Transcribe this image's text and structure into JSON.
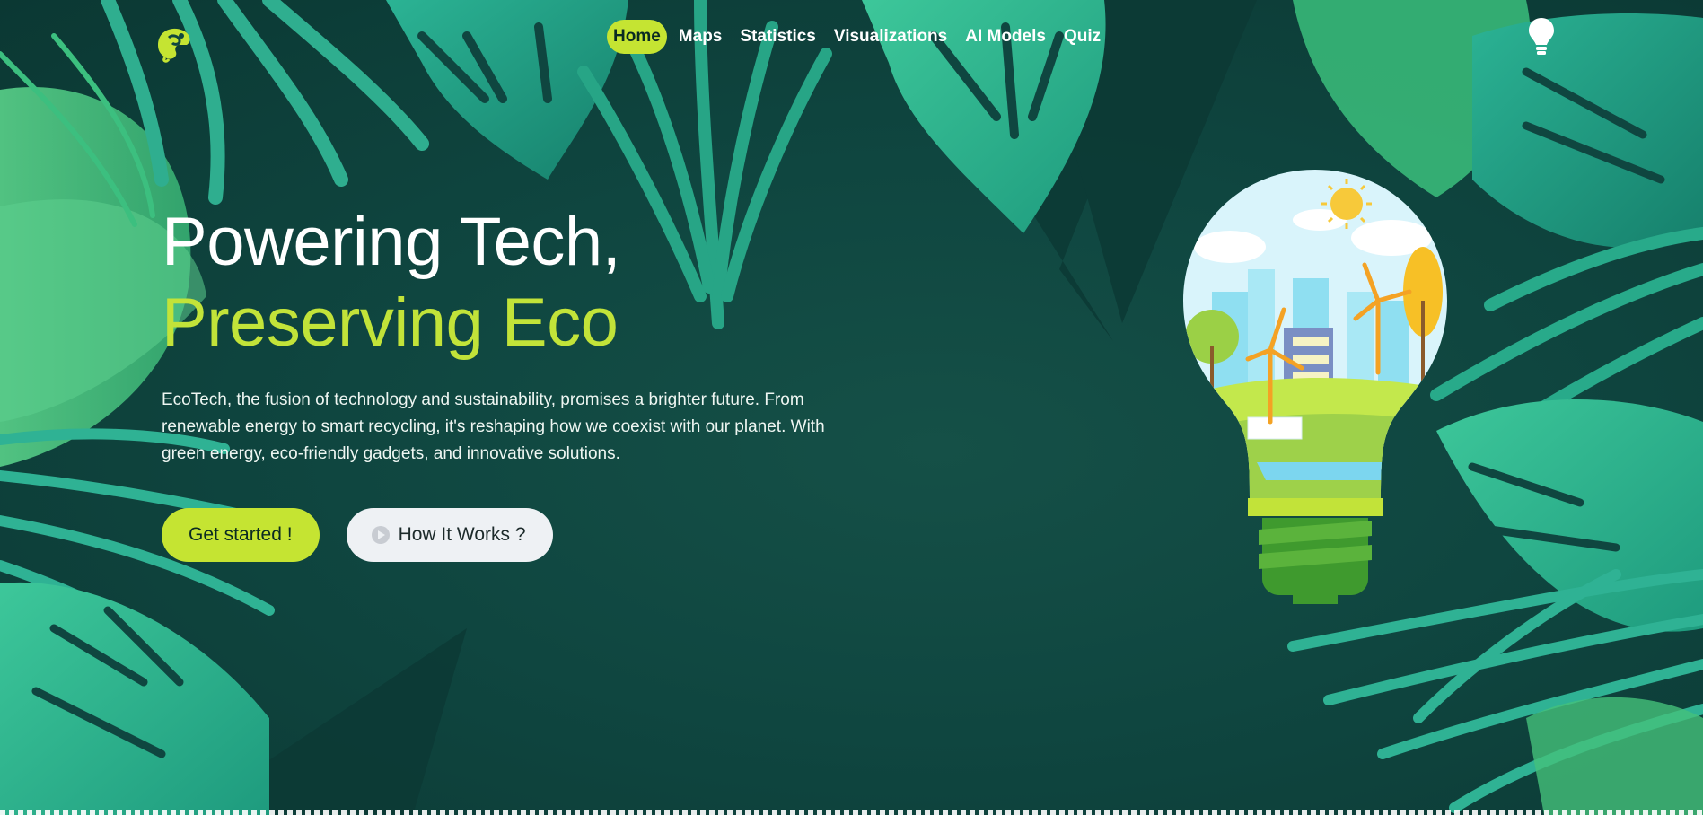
{
  "nav": {
    "logo": "chameleon-logo-icon",
    "links": [
      {
        "label": "Home",
        "active": true
      },
      {
        "label": "Maps",
        "active": false
      },
      {
        "label": "Statistics",
        "active": false
      },
      {
        "label": "Visualizations",
        "active": false
      },
      {
        "label": "AI Models",
        "active": false
      },
      {
        "label": "Quiz",
        "active": false
      }
    ],
    "theme_toggle_icon": "lightbulb-icon"
  },
  "hero": {
    "headline_line1": "Powering Tech,",
    "headline_line2": "Preserving Eco",
    "description": "EcoTech, the fusion of technology and sustainability, promises a brighter future. From renewable energy to smart recycling, it's reshaping how we coexist with our planet. With green energy, eco-friendly gadgets, and innovative solutions.",
    "primary_button": "Get started !",
    "secondary_button": "How It Works ?",
    "secondary_button_icon": "play-circle-icon"
  },
  "illustration": "eco-city-lightbulb-illustration",
  "colors": {
    "accent": "#c5e432",
    "background": "#0f4640",
    "headline_accent": "#c2e339",
    "leaf_light": "#2fb294",
    "leaf_mid": "#1f8f79",
    "leaf_bright": "#45c07b"
  }
}
